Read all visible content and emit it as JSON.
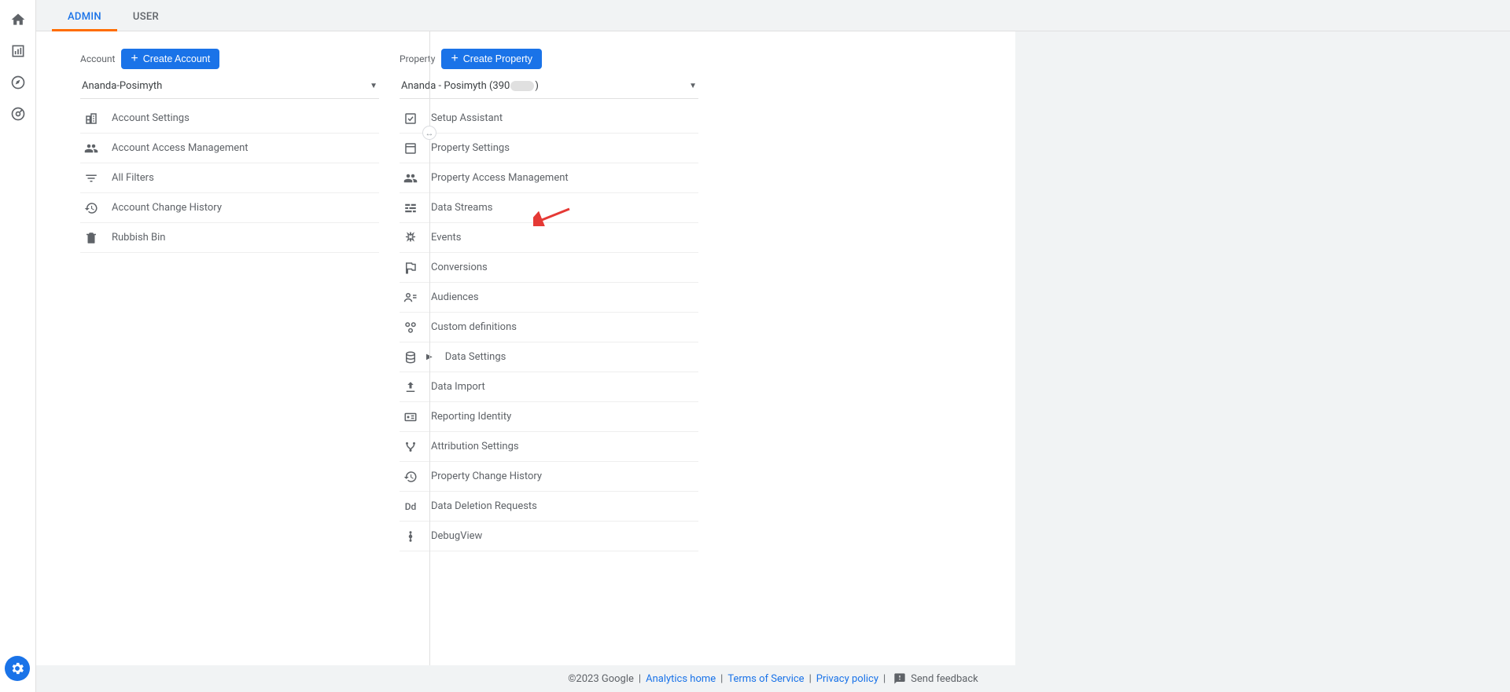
{
  "tabs": [
    {
      "label": "ADMIN",
      "active": true
    },
    {
      "label": "USER",
      "active": false
    }
  ],
  "account": {
    "section_label": "Account",
    "create_button": "Create Account",
    "selected": "Ananda-Posimyth",
    "items": [
      {
        "icon": "building-icon",
        "label": "Account Settings"
      },
      {
        "icon": "people-icon",
        "label": "Account Access Management"
      },
      {
        "icon": "filter-icon",
        "label": "All Filters"
      },
      {
        "icon": "history-icon",
        "label": "Account Change History"
      },
      {
        "icon": "trash-icon",
        "label": "Rubbish Bin"
      }
    ]
  },
  "property": {
    "section_label": "Property",
    "create_button": "Create Property",
    "selected_prefix": "Ananda - Posimyth (390",
    "selected_suffix": ")",
    "items": [
      {
        "icon": "check-square-icon",
        "label": "Setup Assistant"
      },
      {
        "icon": "square-icon",
        "label": "Property Settings"
      },
      {
        "icon": "people-icon",
        "label": "Property Access Management"
      },
      {
        "icon": "stream-icon",
        "label": "Data Streams"
      },
      {
        "icon": "event-icon",
        "label": "Events"
      },
      {
        "icon": "flag-icon",
        "label": "Conversions"
      },
      {
        "icon": "audience-icon",
        "label": "Audiences"
      },
      {
        "icon": "custom-def-icon",
        "label": "Custom definitions"
      },
      {
        "icon": "database-icon",
        "label": "Data Settings",
        "expandable": true
      },
      {
        "icon": "upload-icon",
        "label": "Data Import"
      },
      {
        "icon": "identity-icon",
        "label": "Reporting Identity"
      },
      {
        "icon": "attribution-icon",
        "label": "Attribution Settings"
      },
      {
        "icon": "history-icon",
        "label": "Property Change History"
      },
      {
        "icon": "dd-icon",
        "label": "Data Deletion Requests"
      },
      {
        "icon": "debug-icon",
        "label": "DebugView"
      }
    ]
  },
  "footer": {
    "copyright": "©2023 Google",
    "links": [
      {
        "label": "Analytics home"
      },
      {
        "label": "Terms of Service"
      },
      {
        "label": "Privacy policy"
      }
    ],
    "feedback": "Send feedback"
  },
  "annotation": {
    "target": "Data Streams"
  }
}
